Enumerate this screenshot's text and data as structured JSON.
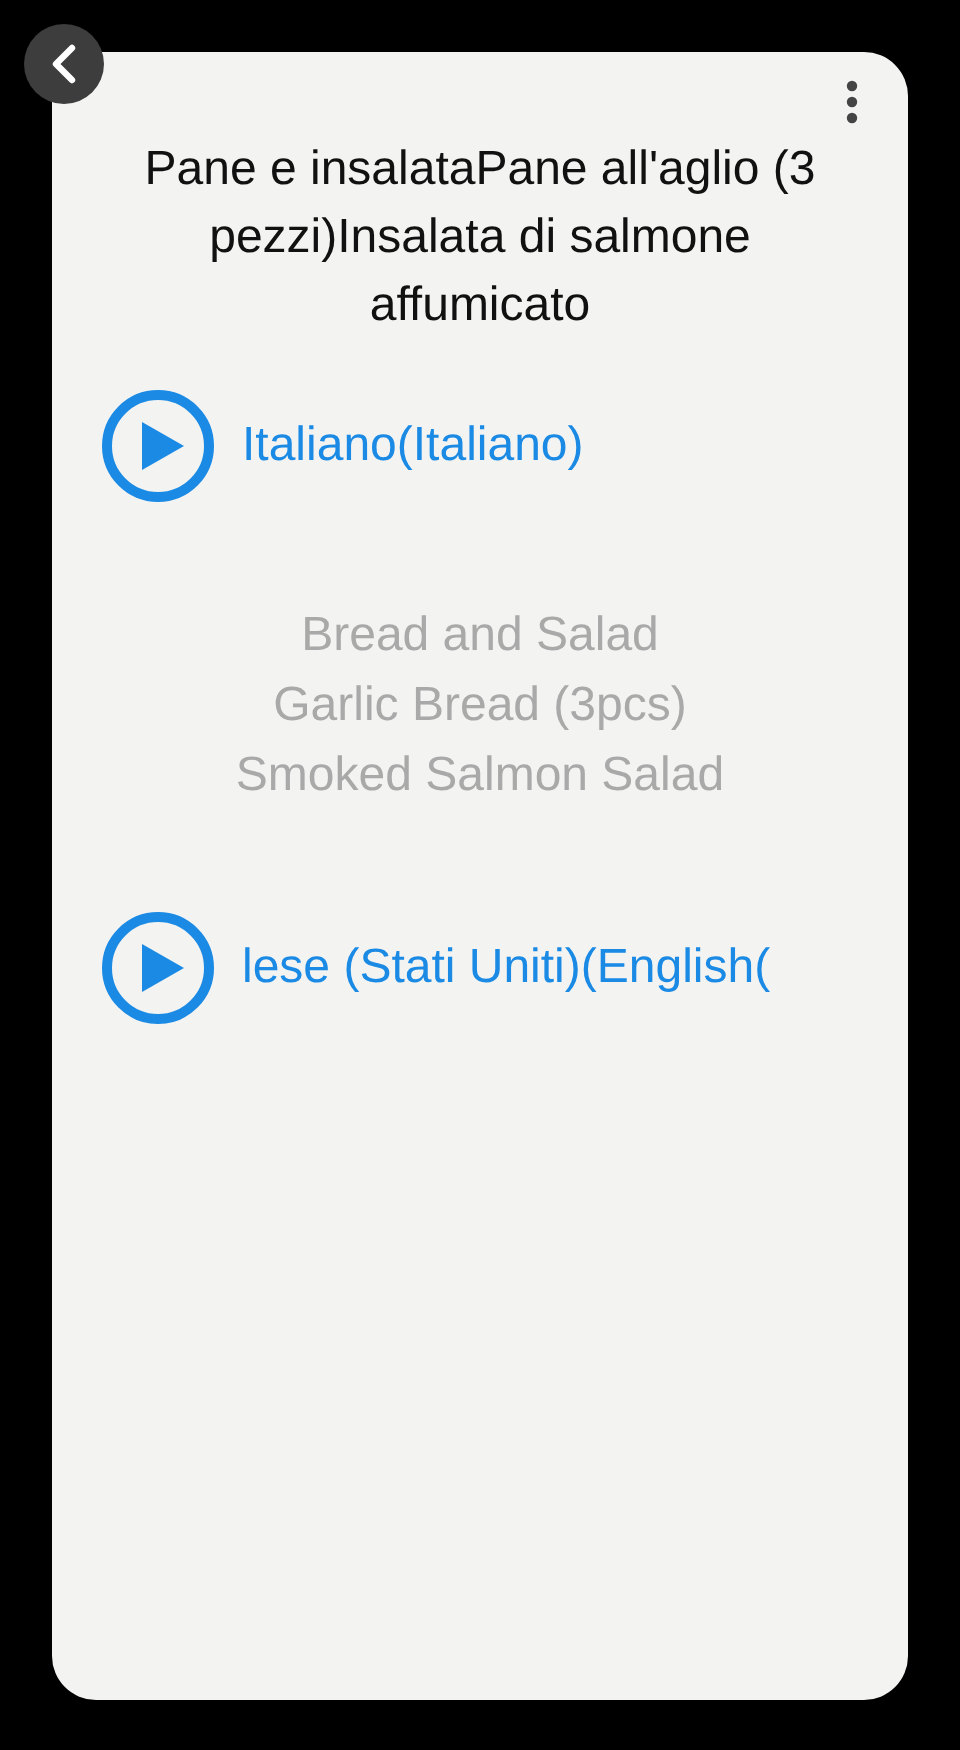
{
  "title": "Pane e insalataPane all'aglio (3 pezzi)Insalata di salmone affumicato",
  "languages": [
    {
      "label": "Italiano(Italiano)",
      "translation": [
        "Bread and Salad",
        "Garlic Bread (3pcs)",
        "Smoked Salmon Salad"
      ]
    },
    {
      "label": "lese (Stati Uniti)(English("
    }
  ]
}
